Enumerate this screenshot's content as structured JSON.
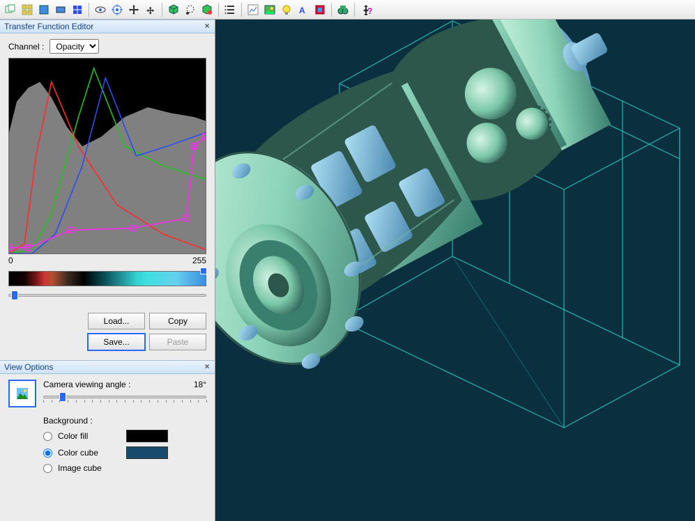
{
  "toolbar": {
    "icons": [
      "cascade-icon",
      "arrange-icon",
      "new-window-icon",
      "rectangle-icon",
      "grid-blue-icon",
      "eye-icon",
      "target-icon",
      "move-icon",
      "zoom-icon",
      "cube-green-icon",
      "lasso-icon",
      "cube-paint-icon",
      "list-icon",
      "chart-icon",
      "photo-icon",
      "bulb-icon",
      "font-icon",
      "adjust-icon",
      "binoculars-icon",
      "help-icon"
    ],
    "separators_after": [
      4,
      8,
      11,
      12,
      17,
      18
    ]
  },
  "transfer_function_editor": {
    "title": "Transfer Function Editor",
    "channel_label": "Channel :",
    "channel_value": "Opacity",
    "channel_options": [
      "Opacity"
    ],
    "scale_min": "0",
    "scale_max": "255",
    "gradient_thumb_left_pct": 99,
    "opacity_slider_pct": 3,
    "buttons": {
      "load": "Load...",
      "copy": "Copy",
      "save": "Save...",
      "paste": "Paste"
    }
  },
  "chart_data": {
    "type": "line",
    "xlim": [
      0,
      255
    ],
    "ylim": [
      0,
      1
    ],
    "xlabel": "",
    "ylabel": "",
    "series": [
      {
        "name": "histogram-fill",
        "color": "#000000",
        "x": [
          0,
          10,
          25,
          40,
          55,
          75,
          95,
          120,
          150,
          180,
          210,
          240,
          255
        ],
        "values": [
          0.62,
          0.78,
          0.85,
          0.88,
          0.8,
          0.65,
          0.55,
          0.6,
          0.7,
          0.75,
          0.72,
          0.7,
          0.68
        ]
      },
      {
        "name": "red",
        "color": "#ff2a2a",
        "x": [
          0,
          20,
          35,
          55,
          90,
          140,
          200,
          255
        ],
        "values": [
          0.0,
          0.05,
          0.5,
          0.88,
          0.55,
          0.25,
          0.1,
          0.02
        ]
      },
      {
        "name": "green",
        "color": "#1ec21e",
        "x": [
          0,
          30,
          55,
          90,
          110,
          150,
          200,
          255
        ],
        "values": [
          0.0,
          0.02,
          0.2,
          0.7,
          0.95,
          0.55,
          0.45,
          0.38
        ]
      },
      {
        "name": "blue",
        "color": "#2a4df2",
        "x": [
          0,
          30,
          60,
          95,
          125,
          165,
          205,
          255
        ],
        "values": [
          0.0,
          0.0,
          0.1,
          0.45,
          0.9,
          0.5,
          0.55,
          0.62
        ]
      },
      {
        "name": "opacity",
        "color": "#ff2af2",
        "x": [
          0,
          25,
          80,
          160,
          230,
          240,
          255
        ],
        "values": [
          0.03,
          0.03,
          0.12,
          0.13,
          0.18,
          0.55,
          0.6
        ],
        "markers": true
      }
    ]
  },
  "view_options": {
    "title": "View Options",
    "camera_label": "Camera viewing angle :",
    "camera_value": "18°",
    "camera_slider_pct": 12,
    "background_label": "Background :",
    "options": [
      {
        "key": "color_fill",
        "label": "Color fill",
        "checked": false,
        "swatch": "#000000"
      },
      {
        "key": "color_cube",
        "label": "Color cube",
        "checked": true,
        "swatch": "#184a6b"
      },
      {
        "key": "image_cube",
        "label": "Image cube",
        "checked": false,
        "swatch": null
      }
    ]
  },
  "viewport": {
    "bg": "#0a2f3f",
    "wire_color": "#29e5d8"
  }
}
